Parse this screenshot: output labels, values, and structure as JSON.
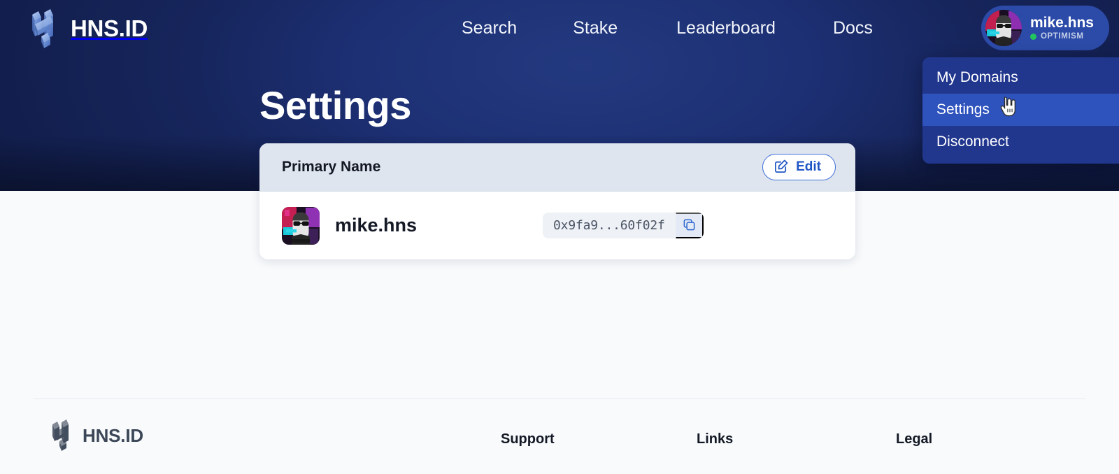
{
  "brand": {
    "name": "HNS.ID",
    "logo_icon": "hns-cube-logo-icon"
  },
  "nav": {
    "items": [
      {
        "label": "Search"
      },
      {
        "label": "Stake"
      },
      {
        "label": "Leaderboard"
      },
      {
        "label": "Docs"
      }
    ]
  },
  "user": {
    "name": "mike.hns",
    "network": "OPTIMISM",
    "status_color": "#22c55e",
    "avatar_icon": "user-avatar",
    "menu": {
      "items": [
        {
          "label": "My Domains",
          "active": false
        },
        {
          "label": "Settings",
          "active": true
        },
        {
          "label": "Disconnect",
          "active": false
        }
      ]
    }
  },
  "page": {
    "title": "Settings"
  },
  "primary_name_card": {
    "header_title": "Primary Name",
    "edit_label": "Edit",
    "edit_icon": "pencil-square-icon",
    "domain": "mike.hns",
    "address": "0x9fa9...60f02f",
    "copy_icon": "copy-icon",
    "avatar_icon": "domain-avatar"
  },
  "footer": {
    "brand": "HNS.ID",
    "columns": [
      {
        "title": "Support"
      },
      {
        "title": "Links"
      },
      {
        "title": "Legal"
      }
    ]
  },
  "cursor": {
    "icon": "pointer-hand-cursor"
  },
  "theme": {
    "accent_blue": "#1f56c4",
    "hero_navy": "#16255e",
    "pill_blue": "#2c4ba8",
    "dropdown_blue": "#21378e",
    "dropdown_active": "#2f53bd",
    "page_bg": "#f8fafc",
    "card_head_bg": "#dfe5ef"
  }
}
